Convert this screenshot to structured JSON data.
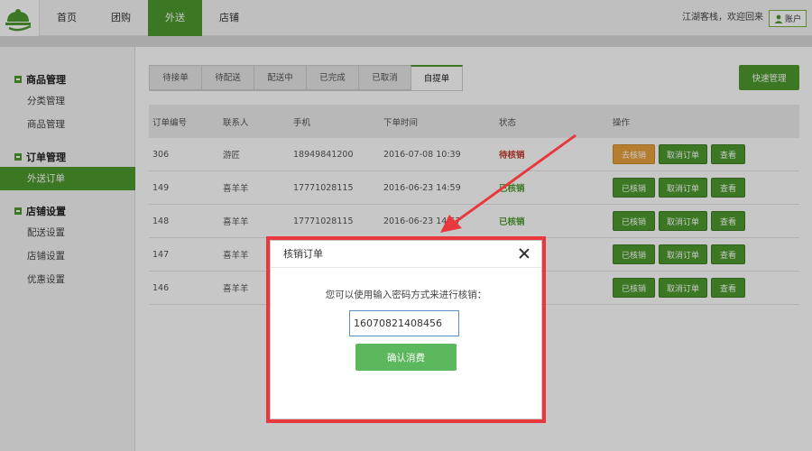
{
  "topbar": {
    "nav": [
      "首页",
      "团购",
      "外送",
      "店铺"
    ],
    "active_nav_index": 2,
    "welcome": "江湖客栈，欢迎回来",
    "account": "账户"
  },
  "sidebar": {
    "groups": [
      {
        "title": "商品管理",
        "items": [
          "分类管理",
          "商品管理"
        ]
      },
      {
        "title": "订单管理",
        "items": [
          "外送订单"
        ]
      },
      {
        "title": "店铺设置",
        "items": [
          "配送设置",
          "店铺设置",
          "优惠设置"
        ]
      }
    ],
    "active_item": "外送订单"
  },
  "tabs": [
    "待接单",
    "待配送",
    "配送中",
    "已完成",
    "已取消",
    "自提单"
  ],
  "active_tab_index": 5,
  "quick_manage": "快速管理",
  "table": {
    "headers": [
      "订单编号",
      "联系人",
      "手机",
      "下单时间",
      "状态",
      "操作"
    ],
    "rows": [
      {
        "id": "306",
        "contact": "游匠",
        "phone": "18949841200",
        "time": "2016-07-08 10:39",
        "status": "待核销",
        "verify": "去核销",
        "cancel": "取消订单",
        "view": "查看"
      },
      {
        "id": "149",
        "contact": "喜羊羊",
        "phone": "17771028115",
        "time": "2016-06-23 14:59",
        "status": "已核销",
        "verify": "已核销",
        "cancel": "取消订单",
        "view": "查看"
      },
      {
        "id": "148",
        "contact": "喜羊羊",
        "phone": "17771028115",
        "time": "2016-06-23 14:57",
        "status": "已核销",
        "verify": "已核销",
        "cancel": "取消订单",
        "view": "查看"
      },
      {
        "id": "147",
        "contact": "喜羊羊",
        "phone": "",
        "time": "",
        "status": "",
        "verify": "已核销",
        "cancel": "取消订单",
        "view": "查看"
      },
      {
        "id": "146",
        "contact": "喜羊羊",
        "phone": "",
        "time": "",
        "status": "",
        "verify": "已核销",
        "cancel": "取消订单",
        "view": "查看"
      }
    ]
  },
  "modal": {
    "title": "核销订单",
    "tip": "您可以使用输入密码方式来进行核销：",
    "input_value": "16070821408456",
    "confirm": "确认消费"
  },
  "colors": {
    "brand": "#4e9a2f",
    "highlight": "#e8383d",
    "pending": "#c0392b",
    "orange": "#e8a23c"
  }
}
